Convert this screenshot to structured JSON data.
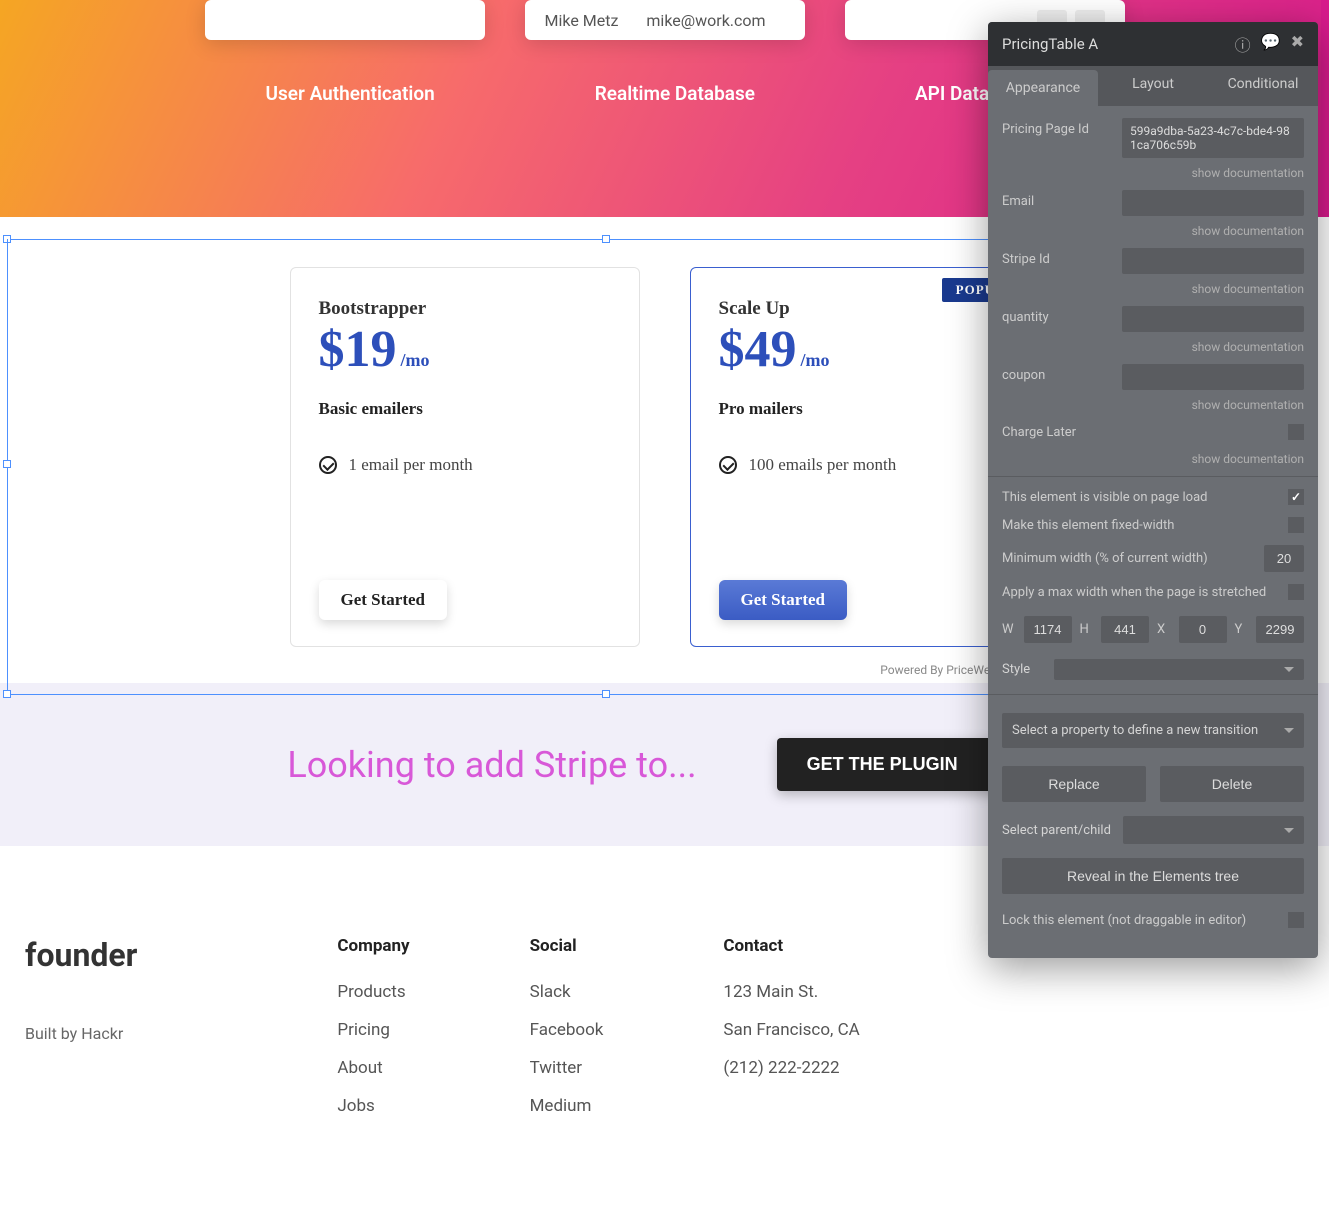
{
  "hero": {
    "card_name": "Mike Metz",
    "card_email": "mike@work.com",
    "labels": [
      "User Authentication",
      "Realtime Database",
      "API Data Sources"
    ]
  },
  "pricing": {
    "plans": [
      {
        "name": "Bootstrapper",
        "price": "$19",
        "period": "/mo",
        "subtitle": "Basic emailers",
        "feature": "1 email per month",
        "cta": "Get Started",
        "popular": false
      },
      {
        "name": "Scale Up",
        "price": "$49",
        "period": "/mo",
        "subtitle": "Pro mailers",
        "feature": "100 emails per month",
        "cta": "Get Started",
        "popular": true,
        "badge": "POPULAR"
      }
    ],
    "powered": "Powered By PriceWell.io"
  },
  "cta": {
    "text": "Looking to add Stripe to...",
    "button": "GET THE PLUGIN"
  },
  "footer": {
    "brand": "founder",
    "sub": "Built by Hackr",
    "cols": [
      {
        "title": "Company",
        "links": [
          "Products",
          "Pricing",
          "About",
          "Jobs"
        ]
      },
      {
        "title": "Social",
        "links": [
          "Slack",
          "Facebook",
          "Twitter",
          "Medium"
        ]
      },
      {
        "title": "Contact",
        "links": [
          "123 Main St.",
          "San Francisco, CA",
          "(212) 222-2222"
        ]
      }
    ]
  },
  "panel": {
    "title": "PricingTable A",
    "tabs": [
      "Appearance",
      "Layout",
      "Conditional"
    ],
    "props": {
      "pricing_page_id_label": "Pricing Page Id",
      "pricing_page_id_value": "599a9dba-5a23-4c7c-bde4-981ca706c59b",
      "email_label": "Email",
      "stripe_label": "Stripe Id",
      "quantity_label": "quantity",
      "coupon_label": "coupon",
      "charge_later_label": "Charge Later",
      "show_doc": "show documentation"
    },
    "checks": {
      "visible_label": "This element is visible on page load",
      "fixed_label": "Make this element fixed-width",
      "min_width_label": "Minimum width (% of current width)",
      "min_width_value": "20",
      "max_width_label": "Apply a max width when the page is stretched"
    },
    "dims": {
      "W": "1174",
      "H": "441",
      "X": "0",
      "Y": "2299"
    },
    "style_label": "Style",
    "transition_label": "Select a property to define a new transition",
    "replace": "Replace",
    "delete": "Delete",
    "select_parent_label": "Select parent/child",
    "reveal": "Reveal in the Elements tree",
    "lock_label": "Lock this element (not draggable in editor)"
  }
}
